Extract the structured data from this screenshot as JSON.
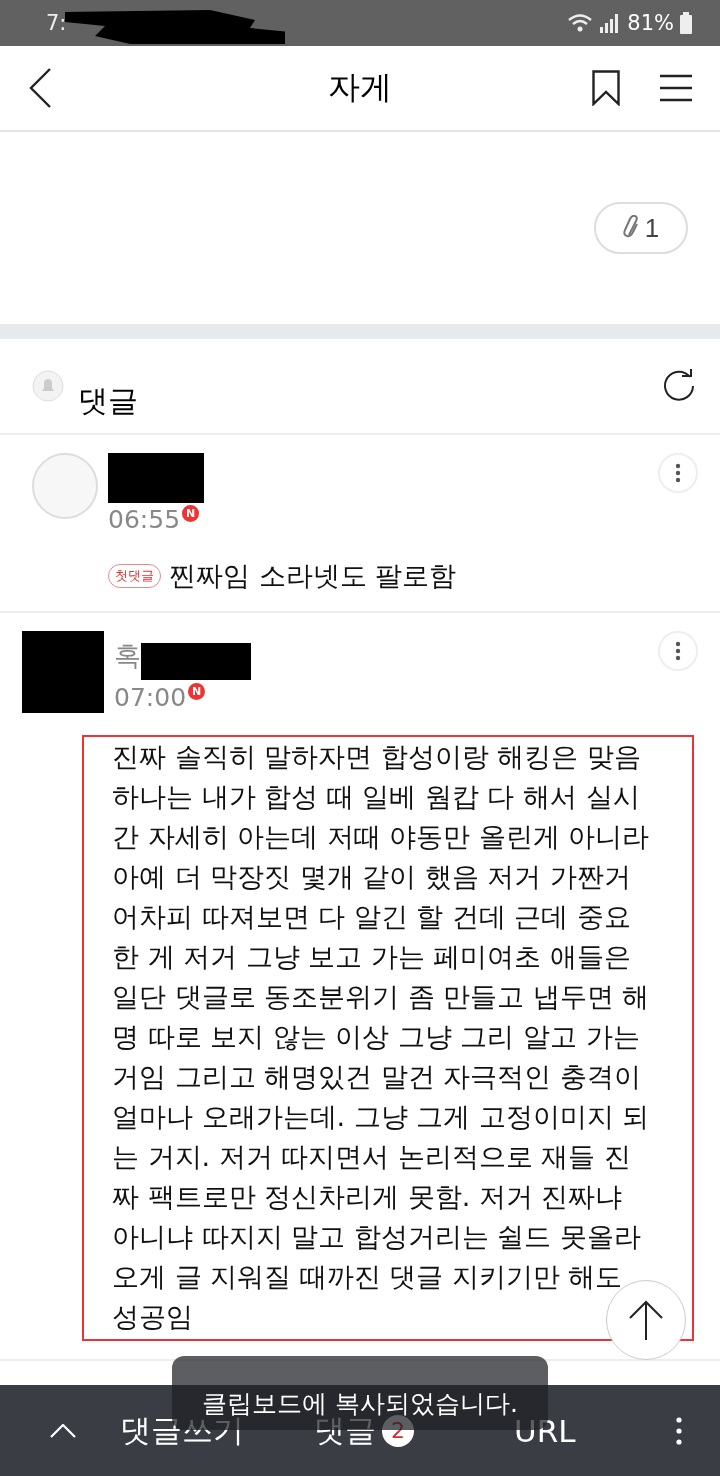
{
  "status_bar": {
    "time": "7:",
    "battery": "81%"
  },
  "header": {
    "title": "자게"
  },
  "attachment": {
    "count": "1"
  },
  "comments_section": {
    "title": "댓글"
  },
  "comments": [
    {
      "kind": "avatar",
      "time": "06:55",
      "new_badge": "N",
      "tag": "첫댓글",
      "selected": false,
      "lines": [
        "찐짜임 소라넷도 팔로함"
      ]
    },
    {
      "kind": "redacted",
      "author": "혹",
      "time": "07:00",
      "new_badge": "N",
      "selected": true,
      "lines": [
        "진짜 솔직히 말하자면 합성이랑 해킹은 맞음",
        "하나는 내가 합성 때 일베 웜캅 다 해서 실시",
        "간 자세히 아는데 저때 야동만 올린게 아니라",
        "아예 더 막장짓 몇개 같이 했음 저거 가짠거",
        "어차피 따져보면 다 알긴 할 건데 근데 중요",
        "한 게 저거 그냥 보고 가는 페미여초 애들은",
        "일단 댓글로 동조분위기 좀 만들고 냅두면 해",
        "명 따로 보지 않는 이상 그냥 그리 알고 가는",
        "거임 그리고 해명있건 말건 자극적인 충격이",
        "얼마나 오래가는데. 그냥 그게 고정이미지 되",
        "는 거지. 저거 따지면서 논리적으로 재들 진",
        "짜 팩트로만 정신차리게 못함. 저거 진짜냐",
        "아니냐 따지지 말고 합성거리는 쉴드 못올라",
        "오게 글 지워질 때까진 댓글 지키기만 해도",
        "성공임"
      ]
    }
  ],
  "bottom_bar": {
    "write": "댓글쓰기",
    "comments": "댓글",
    "comment_count": "2",
    "url": "URL"
  },
  "toast": "클립보드에 복사되었습니다."
}
